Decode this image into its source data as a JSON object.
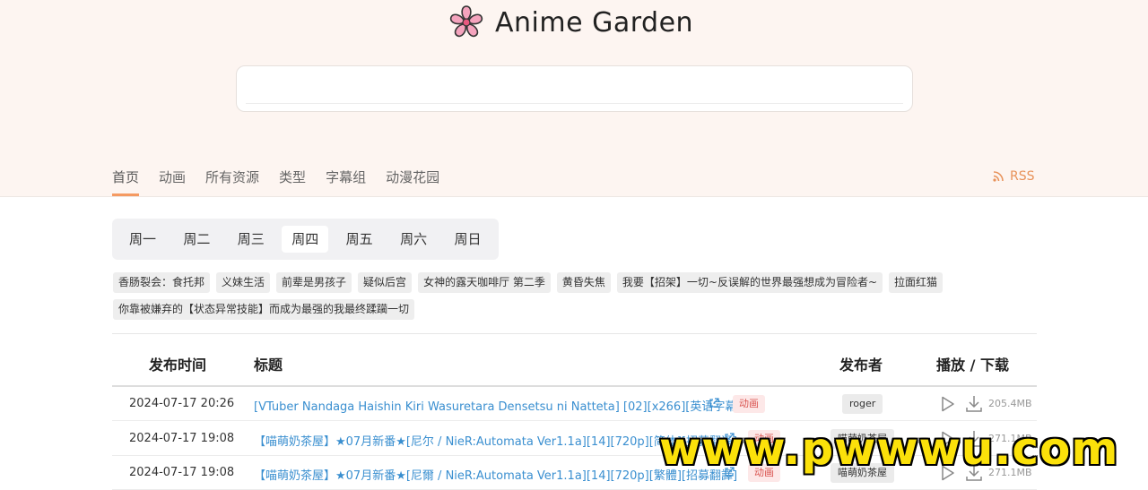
{
  "header": {
    "brand": "Anime Garden",
    "logo_icon": "cherry-blossom-icon"
  },
  "search": {
    "value": "",
    "placeholder": ""
  },
  "nav": {
    "items": [
      "首页",
      "动画",
      "所有资源",
      "类型",
      "字幕组",
      "动漫花园"
    ],
    "active": "首页",
    "rss_label": "RSS"
  },
  "weekdays": {
    "items": [
      "周一",
      "周二",
      "周三",
      "周四",
      "周五",
      "周六",
      "周日"
    ],
    "active": "周四"
  },
  "tags": [
    "香肠裂会：食托邦",
    "义妹生活",
    "前辈是男孩子",
    "疑似后宫",
    "女神的露天咖啡厅 第二季",
    "黄昏失焦",
    "我要【招架】一切~反误解的世界最强想成为冒险者~",
    "拉面红猫",
    "你靠被嫌弃的【状态异常技能】而成为最强的我最终蹂躏一切"
  ],
  "table": {
    "headers": {
      "time": "发布时间",
      "title": "标题",
      "publisher": "发布者",
      "action": "播放 / 下载"
    },
    "rows": [
      {
        "date": "2024-07-17 20:26",
        "title": "[VTuber Nandaga Haishin Kiri Wasuretara Densetsu ni Natteta] [02][x266][英语字幕]",
        "type": "动画",
        "publisher": "roger",
        "size": "205.4MB"
      },
      {
        "date": "2024-07-17 19:08",
        "title": "【喵萌奶茶屋】★07月新番★[尼尔 / NieR:Automata Ver1.1a][14][720p][简体][招募翻译]",
        "type": "动画",
        "publisher": "喵萌奶茶屋",
        "size": "271.1MB"
      },
      {
        "date": "2024-07-17 19:08",
        "title": "【喵萌奶茶屋】★07月新番★[尼爾 / NieR:Automata Ver1.1a][14][720p][繁體][招募翻譯]",
        "type": "动画",
        "publisher": "喵萌奶茶屋",
        "size": "271.1MB"
      }
    ]
  },
  "watermark": "www.pwwwu.com",
  "colors": {
    "accent": "#f59a62",
    "link": "#3a8fd0",
    "hero_bg": "#fdf5f1",
    "type_badge": "#d9534f",
    "watermark": "#fbe10a"
  }
}
